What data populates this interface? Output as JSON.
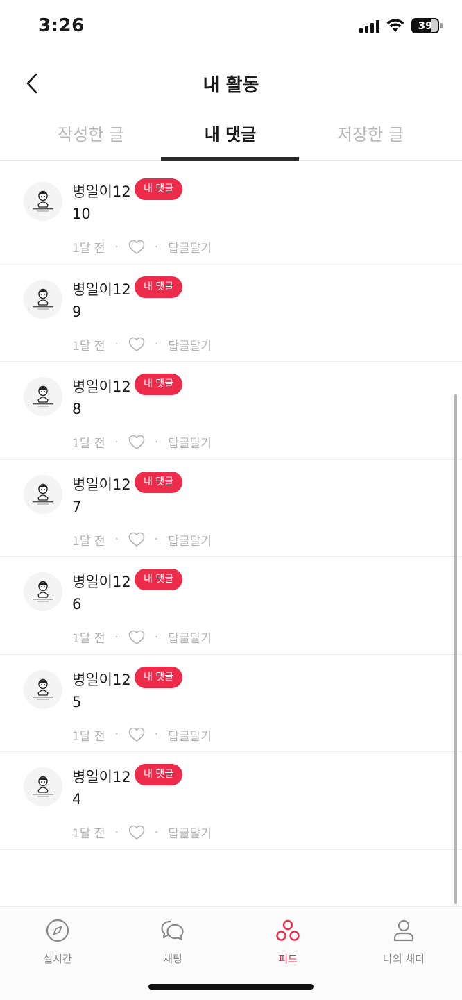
{
  "status_bar": {
    "time": "3:26",
    "battery": "39"
  },
  "header": {
    "title": "내 활동"
  },
  "tabs": [
    {
      "label": "작성한 글",
      "active": false
    },
    {
      "label": "내 댓글",
      "active": true
    },
    {
      "label": "저장한 글",
      "active": false
    }
  ],
  "comments": [
    {
      "author": "병일이12",
      "badge": "내 댓글",
      "text": "10",
      "time": "1달 전",
      "reply_label": "답글달기"
    },
    {
      "author": "병일이12",
      "badge": "내 댓글",
      "text": "9",
      "time": "1달 전",
      "reply_label": "답글달기"
    },
    {
      "author": "병일이12",
      "badge": "내 댓글",
      "text": "8",
      "time": "1달 전",
      "reply_label": "답글달기"
    },
    {
      "author": "병일이12",
      "badge": "내 댓글",
      "text": "7",
      "time": "1달 전",
      "reply_label": "답글달기"
    },
    {
      "author": "병일이12",
      "badge": "내 댓글",
      "text": "6",
      "time": "1달 전",
      "reply_label": "답글달기"
    },
    {
      "author": "병일이12",
      "badge": "내 댓글",
      "text": "5",
      "time": "1달 전",
      "reply_label": "답글달기"
    },
    {
      "author": "병일이12",
      "badge": "내 댓글",
      "text": "4",
      "time": "1달 전",
      "reply_label": "답글달기"
    }
  ],
  "bottom_nav": [
    {
      "label": "실시간",
      "icon": "compass-icon",
      "active": false
    },
    {
      "label": "채팅",
      "icon": "chat-bubbles-icon",
      "active": false
    },
    {
      "label": "피드",
      "icon": "feed-circles-icon",
      "active": true
    },
    {
      "label": "나의 채티",
      "icon": "person-icon",
      "active": false
    }
  ],
  "colors": {
    "accent": "#ec2c4a",
    "muted_text": "#b3b3b3",
    "active_tab_indicator": "#2a2a2a"
  }
}
